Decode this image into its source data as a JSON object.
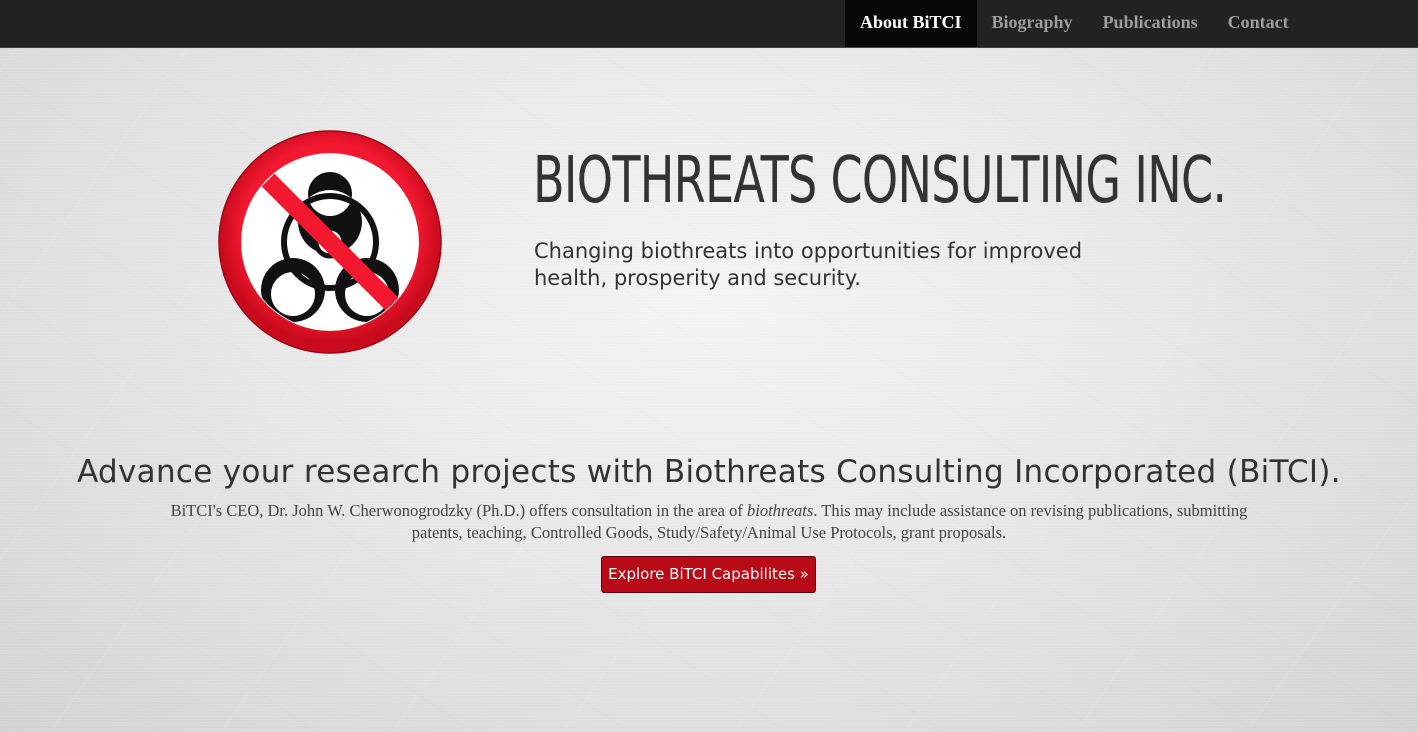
{
  "navbar": {
    "items": [
      {
        "label": "About BiTCI",
        "active": true
      },
      {
        "label": "Biography",
        "active": false
      },
      {
        "label": "Publications",
        "active": false
      },
      {
        "label": "Contact",
        "active": false
      }
    ]
  },
  "hero": {
    "logo_icon": "no-biohazard-icon",
    "title": "BIOTHREATS CONSULTING INC.",
    "subtitle": "Changing biothreats into opportunities for improved health, prosperity and security."
  },
  "intro": {
    "heading": "Advance your research projects with Biothreats Consulting Incorporated (BiTCI).",
    "body_before": "BiTCI's CEO, Dr. John W. Cherwonogrodzky (Ph.D.) offers consultation in the area of ",
    "body_emphasis": "biothreats",
    "body_after": ". This may include assistance on revising publications, submitting patents, teaching, Controlled Goods, Study/Safety/Animal Use Protocols, grant proposals.",
    "button_label": "Explore BiTCI Capabilites »"
  },
  "colors": {
    "navbar_bg": "#222222",
    "nav_active_bg": "#080808",
    "button_bg": "#b80a16",
    "prohibition_red": "#e8102a"
  }
}
